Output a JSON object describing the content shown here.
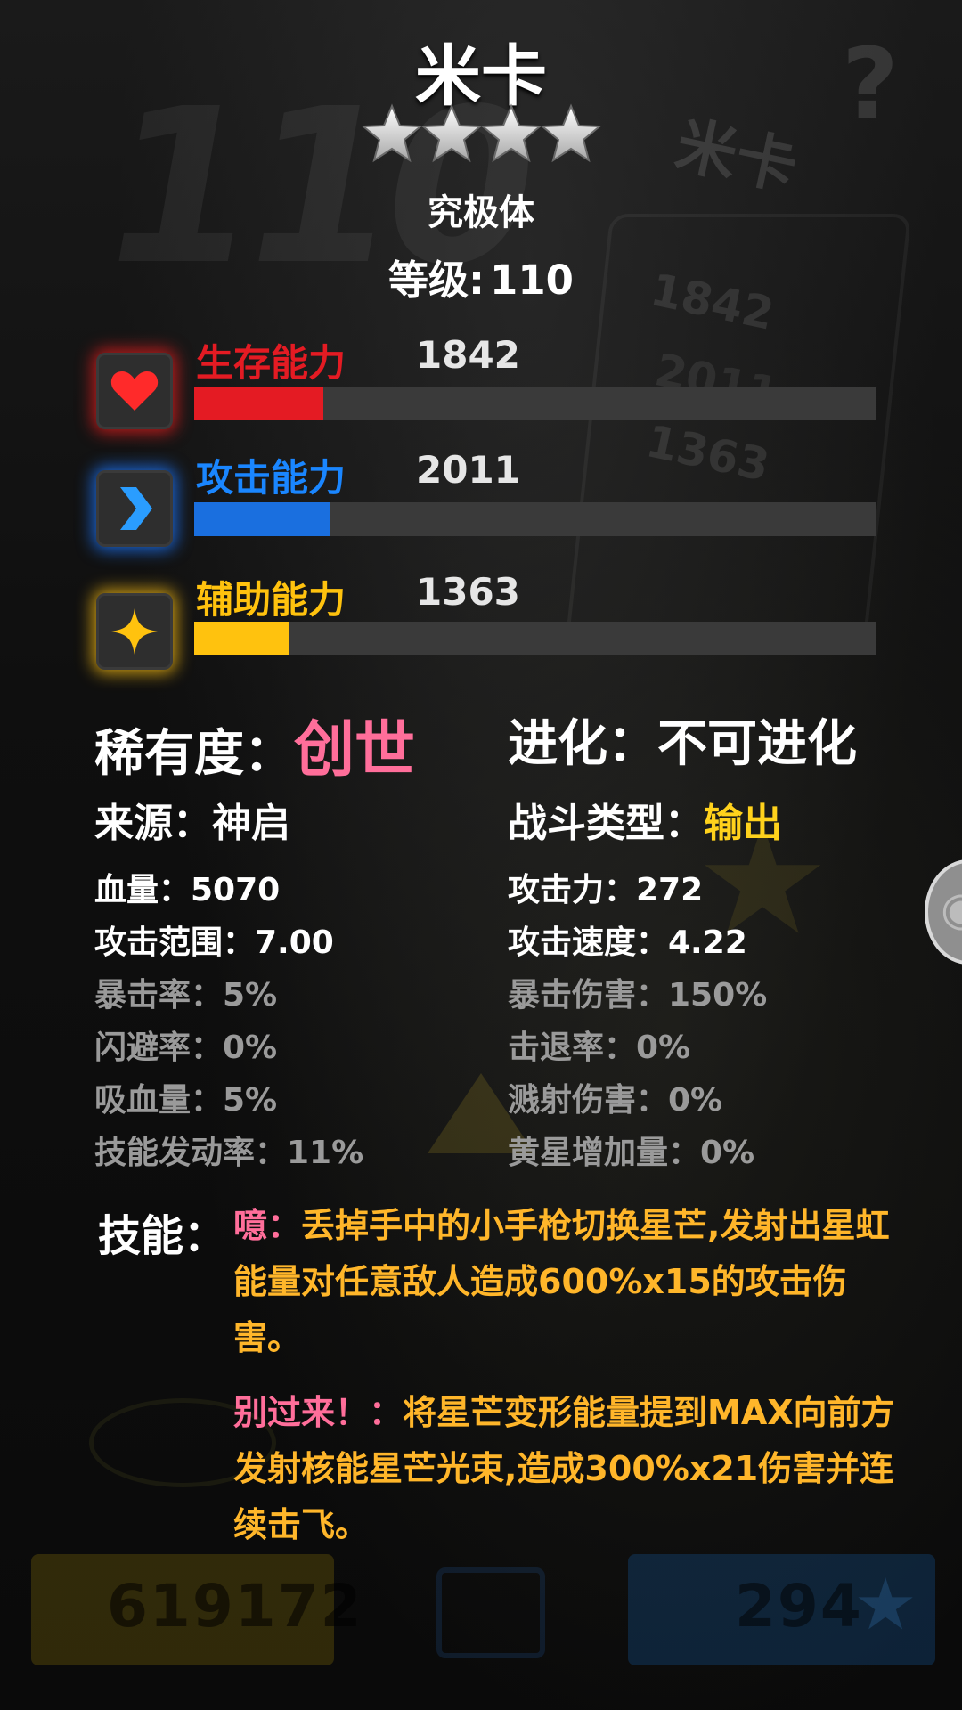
{
  "character": {
    "name": "米卡",
    "stars": 4,
    "form": "究极体",
    "level_label": "等级:",
    "level_value": "110"
  },
  "stats": [
    {
      "label": "生存能力",
      "value": "1842",
      "icon": "heart-icon",
      "color": "#e41b23",
      "fill": 0.19
    },
    {
      "label": "攻击能力",
      "value": "2011",
      "icon": "chevron-right-icon",
      "color": "#1a86ff",
      "fill": 0.2
    },
    {
      "label": "辅助能力",
      "value": "1363",
      "icon": "sparkle-star-icon",
      "color": "#ffc20e",
      "fill": 0.14
    }
  ],
  "info": {
    "rarity_label": "稀有度：",
    "rarity_value": "创世",
    "evolve_label": "进化：",
    "evolve_value": "不可进化",
    "source_label": "来源：",
    "source_value": "神启",
    "battle_label": "战斗类型：",
    "battle_value": "输出"
  },
  "attributes_left": [
    {
      "text": "血量：5070",
      "bright": true
    },
    {
      "text": "攻击范围：7.00",
      "bright": true
    },
    {
      "text": "暴击率：5%",
      "bright": false
    },
    {
      "text": "闪避率：0%",
      "bright": false
    },
    {
      "text": "吸血量：5%",
      "bright": false
    },
    {
      "text": "技能发动率：11%",
      "bright": false
    }
  ],
  "attributes_right": [
    {
      "text": "攻击力：272",
      "bright": true
    },
    {
      "text": "攻击速度：4.22",
      "bright": true
    },
    {
      "text": "暴击伤害：150%",
      "bright": false
    },
    {
      "text": "击退率：0%",
      "bright": false
    },
    {
      "text": "溅射伤害：0%",
      "bright": false
    },
    {
      "text": "黄星增加量：0%",
      "bright": false
    }
  ],
  "skills": {
    "label": "技能：",
    "items": [
      {
        "name": "噫：",
        "desc": "丢掉手中的小手枪切换星芒,发射出星虹能量对任意敌人造成600%x15的攻击伤害。"
      },
      {
        "name": "别过来！：",
        "desc": "将星芒变形能量提到MAX向前方发射核能星芒光束,造成300%x21伤害并连续击飞。"
      }
    ]
  },
  "background": {
    "ghost_level": "110",
    "ghost_name": "米卡",
    "ghost_values": [
      "1842",
      "2011",
      "1363"
    ],
    "bottom_left_value": "619172",
    "bottom_right_value": "294"
  },
  "colors": {
    "pink": "#ff6e9a",
    "orange": "#ffb62a",
    "yellow": "#ffd21c",
    "dim_text": "#9a9a9a"
  }
}
